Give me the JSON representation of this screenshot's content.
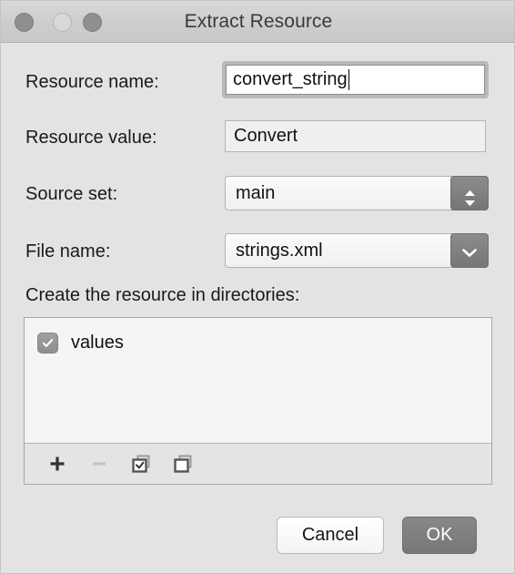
{
  "window": {
    "title": "Extract Resource",
    "controls": {
      "close": "close-button",
      "minimize": "minimize-button",
      "zoom": "zoom-button"
    }
  },
  "form": {
    "resource_name": {
      "label": "Resource name:",
      "value": "convert_string",
      "focused": true
    },
    "resource_value": {
      "label": "Resource value:",
      "value": "Convert"
    },
    "source_set": {
      "label": "Source set:",
      "value": "main",
      "control": "stepper-popup"
    },
    "file_name": {
      "label": "File name:",
      "value": "strings.xml",
      "control": "dropdown"
    }
  },
  "directories": {
    "label": "Create the resource in directories:",
    "items": [
      {
        "name": "values",
        "checked": true
      }
    ],
    "toolbar": [
      {
        "icon": "plus-icon",
        "name": "add-directory-button",
        "enabled": true
      },
      {
        "icon": "minus-icon",
        "name": "remove-directory-button",
        "enabled": false
      },
      {
        "icon": "check-all-icon",
        "name": "select-all-button",
        "enabled": true
      },
      {
        "icon": "uncheck-all-icon",
        "name": "deselect-all-button",
        "enabled": true
      }
    ]
  },
  "buttons": {
    "cancel": "Cancel",
    "ok": "OK"
  },
  "colors": {
    "dialog_background": "#e3e3e3",
    "titlebar": "#cdcdcd",
    "field_background": "#ffffff",
    "accent_button": "#808080",
    "text": "#111111"
  }
}
